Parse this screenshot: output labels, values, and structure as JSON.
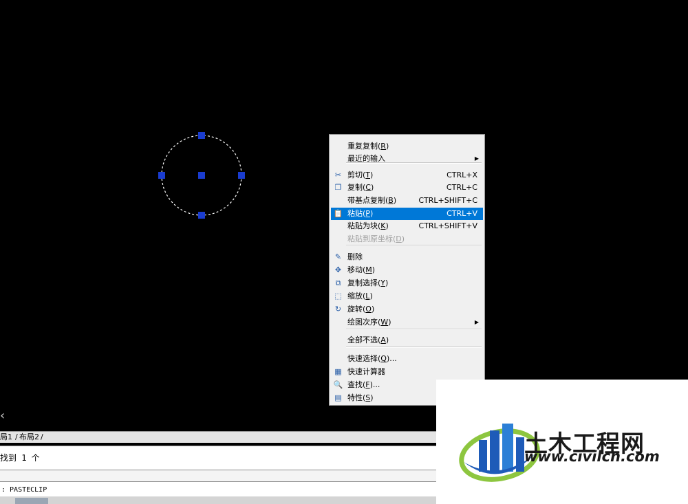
{
  "canvas": {
    "background": "#000000",
    "grip_color": "#1a3ccf"
  },
  "context_menu": {
    "items": [
      {
        "label": "重复复制",
        "accel": "R",
        "shortcut": "",
        "submenu": false,
        "icon": ""
      },
      {
        "label": "最近的输入",
        "accel": "",
        "shortcut": "",
        "submenu": true,
        "icon": ""
      },
      {
        "label": "剪切",
        "accel": "T",
        "shortcut": "CTRL+X",
        "submenu": false,
        "icon": "scissors-icon"
      },
      {
        "label": "复制",
        "accel": "C",
        "shortcut": "CTRL+C",
        "submenu": false,
        "icon": "copy-icon"
      },
      {
        "label": "带基点复制",
        "accel": "B",
        "shortcut": "CTRL+SHIFT+C",
        "submenu": false,
        "icon": ""
      },
      {
        "label": "粘贴",
        "accel": "P",
        "shortcut": "CTRL+V",
        "submenu": false,
        "icon": "paste-icon",
        "selected": true
      },
      {
        "label": "粘贴为块",
        "accel": "K",
        "shortcut": "CTRL+SHIFT+V",
        "submenu": false,
        "icon": ""
      },
      {
        "label": "粘贴到原坐标",
        "accel": "D",
        "shortcut": "",
        "submenu": false,
        "icon": "",
        "disabled": true
      },
      {
        "label": "删除",
        "accel": "",
        "shortcut": "",
        "submenu": false,
        "icon": "eraser-icon"
      },
      {
        "label": "移动",
        "accel": "M",
        "shortcut": "",
        "submenu": false,
        "icon": "move-icon"
      },
      {
        "label": "复制选择",
        "accel": "Y",
        "shortcut": "",
        "submenu": false,
        "icon": "copy-selection-icon"
      },
      {
        "label": "缩放",
        "accel": "L",
        "shortcut": "",
        "submenu": false,
        "icon": "scale-icon"
      },
      {
        "label": "旋转",
        "accel": "O",
        "shortcut": "",
        "submenu": false,
        "icon": "rotate-icon"
      },
      {
        "label": "绘图次序",
        "accel": "W",
        "shortcut": "",
        "submenu": true,
        "icon": ""
      },
      {
        "label": "全部不选",
        "accel": "A",
        "shortcut": "",
        "submenu": false,
        "icon": ""
      },
      {
        "label": "快速选择",
        "accel": "Q",
        "suffix": "...",
        "shortcut": "",
        "submenu": false,
        "icon": ""
      },
      {
        "label": "快速计算器",
        "accel": "",
        "shortcut": "",
        "submenu": false,
        "icon": "calculator-icon"
      },
      {
        "label": "查找",
        "accel": "F",
        "suffix": "...",
        "shortcut": "",
        "submenu": false,
        "icon": "find-icon"
      },
      {
        "label": "特性",
        "accel": "S",
        "shortcut": "",
        "submenu": false,
        "icon": "properties-icon"
      }
    ],
    "selected_color": "#0078d7"
  },
  "layout_tabs": {
    "tab1": "局1",
    "tab2": "布局2"
  },
  "command_history": {
    "text": "找到 1 个"
  },
  "command_line": {
    "text": ": PASTECLIP"
  },
  "watermark": {
    "title": "土木工程网",
    "url": "www.civilcn.com",
    "brand_blue": "#1e5bb8",
    "brand_green": "#8dc63f"
  }
}
